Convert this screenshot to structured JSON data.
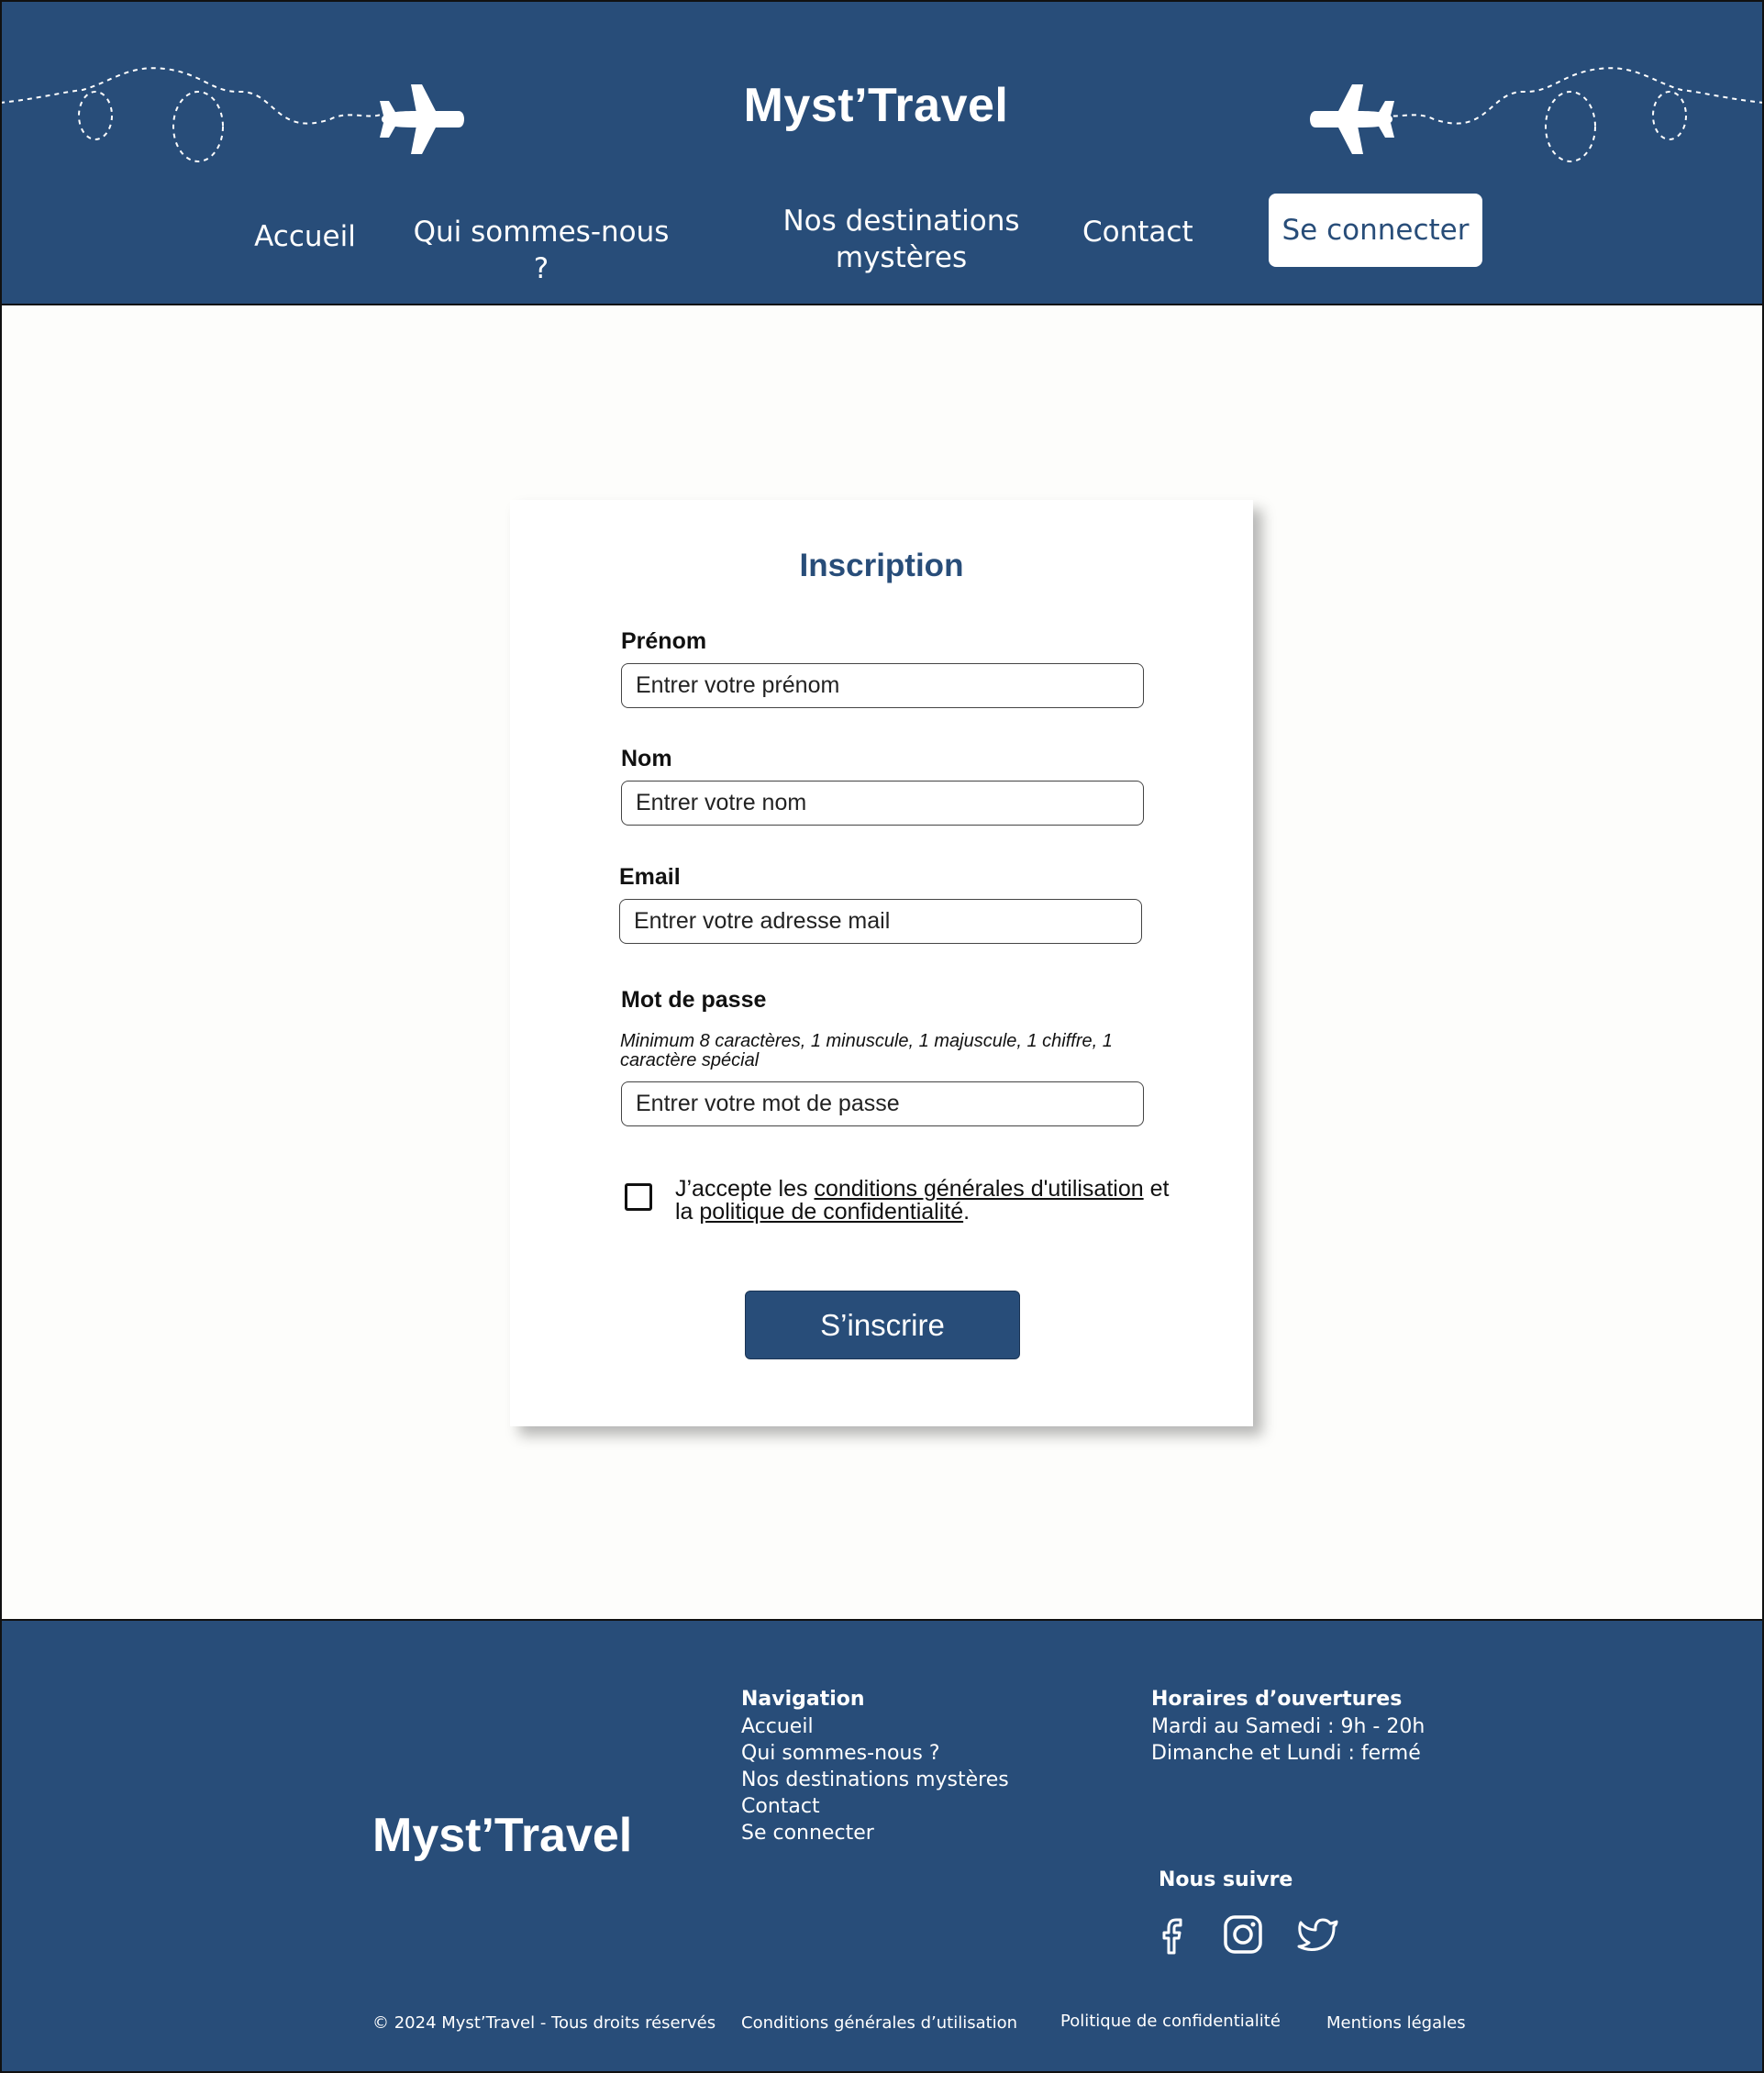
{
  "header": {
    "brand": "Myst’Travel",
    "nav": {
      "accueil": "Accueil",
      "qui": "Qui sommes-nous ?",
      "dest_line1": "Nos destinations",
      "dest_line2": "mystères",
      "contact": "Contact"
    },
    "login_button": "Se connecter"
  },
  "form": {
    "title": "Inscription",
    "firstname": {
      "label": "Prénom",
      "placeholder": "Entrer votre prénom",
      "value": ""
    },
    "lastname": {
      "label": "Nom",
      "placeholder": "Entrer votre nom",
      "value": ""
    },
    "email": {
      "label": "Email",
      "placeholder": "Entrer votre adresse mail",
      "value": ""
    },
    "password": {
      "label": "Mot de passe",
      "hint": "Minimum 8 caractères, 1 minuscule, 1 majuscule, 1 chiffre, 1 caractère spécial",
      "placeholder": "Entrer votre mot de passe",
      "value": ""
    },
    "terms": {
      "checked": false,
      "prefix": "J’accepte les ",
      "cgu_link": "conditions générales d'utilisation",
      "middle": " et la ",
      "privacy_link": "politique de confidentialité",
      "suffix": "."
    },
    "submit_button": "S’inscrire"
  },
  "footer": {
    "brand": "Myst’Travel",
    "navigation": {
      "heading": "Navigation",
      "items": [
        "Accueil",
        "Qui sommes-nous ?",
        "Nos destinations mystères",
        "Contact",
        "Se connecter"
      ]
    },
    "hours": {
      "heading": "Horaires d’ouvertures",
      "lines": [
        "Mardi au Samedi : 9h - 20h",
        "Dimanche et Lundi : fermé"
      ]
    },
    "follow": {
      "heading": "Nous suivre",
      "icons": [
        "facebook-icon",
        "instagram-icon",
        "twitter-icon"
      ]
    },
    "bottom": {
      "copyright": "© 2024 Myst’Travel - Tous droits réservés",
      "cgu": "Conditions générales d’utilisation",
      "privacy": "Politique de confidentialité",
      "legal": "Mentions légales"
    }
  },
  "colors": {
    "brand": "#284d79",
    "background": "#fdfdfb",
    "white": "#ffffff"
  }
}
